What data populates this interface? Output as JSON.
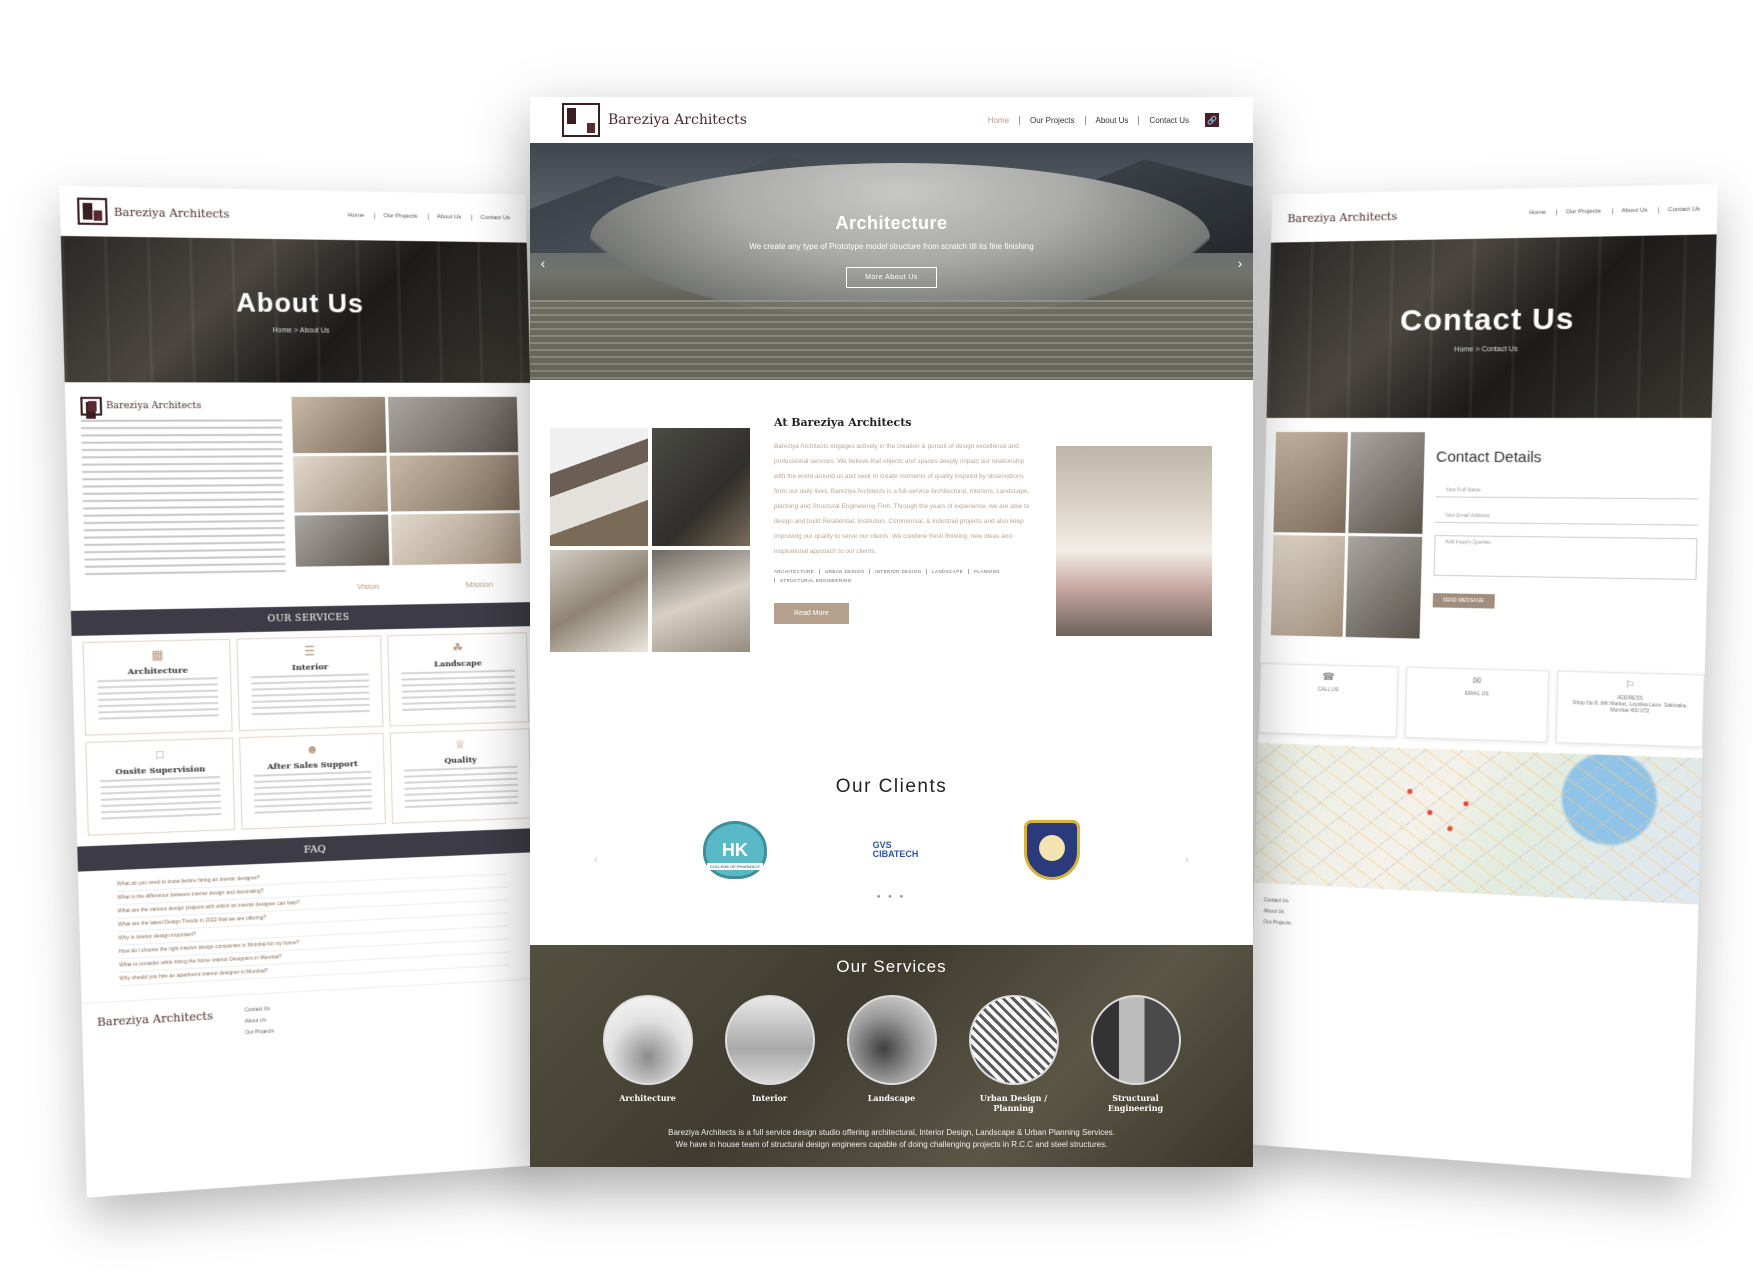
{
  "brand": {
    "name": "Bareziya Architects"
  },
  "nav": {
    "home": "Home",
    "projects": "Our Projects",
    "about": "About Us",
    "contact": "Contact Us"
  },
  "hero": {
    "title": "Architecture",
    "subtitle": "We create any type of Prototype model structure from scratch till its fine finishing",
    "button": "More About Us"
  },
  "about": {
    "heading": "At Bareziya Architects",
    "body": "Bareziya Architects engages actively in the creation & pursuit of design excellence and professional services. We believe that objects and spaces deeply impact our relationship with the world around us and seek to create moments of quality inspired by observations from our daily lives. Bareziya Architects is a full-service Architectural, Interiors, Landscape, planning and Structural Engineering Firm. Through the years of experience, we are able to design and build Residential, Institution, Commercial, & Industrial projects and also keep improving our quality to serve our clients. We combine fresh thinking, new ideas and inspirational approach to our clients.",
    "tags": [
      "ARCHITECTURE",
      "URBAN DESIGN",
      "INTERIOR DESIGN",
      "LANDSCAPE",
      "PLANNING",
      "STRUCTURAL ENGINEERING"
    ],
    "button": "Read More"
  },
  "clients": {
    "heading": "Our Clients",
    "hk_text": "HK",
    "hk_banner": "COLLEGE OF PHARMACY",
    "gvs_line1": "GVS",
    "gvs_line2": "CIBATECH"
  },
  "services": {
    "heading": "Our Services",
    "items": [
      "Architecture",
      "Interior",
      "Landscape",
      "Urban Design / Planning",
      "Structural Engineering"
    ],
    "text_line1": "Bareziya Architects is a full service design studio offering architectural, Interior Design, Landscape & Urban Planning Services.",
    "text_line2": "We have in house team of structural design engineers capable of doing challenging projects in R.C.C and steel structures."
  },
  "left": {
    "title": "About Us",
    "crumb": "Home  >  About Us",
    "vision": "Vision",
    "mission": "Mission",
    "services_bar": "OUR SERVICES",
    "service_cards": [
      "Architecture",
      "Interior",
      "Landscape",
      "Onsite Supervision",
      "After Sales Support",
      "Quality"
    ],
    "faq_bar": "FAQ",
    "faqs": [
      "What do you need to know before hiring an interior designer?",
      "What is the difference between interior design and decorating?",
      "What are the various design projects with which an interior designer can help?",
      "What are the latest Design Trends in 2022 that we are offering?",
      "Why is interior design important?",
      "How do I choose the right interior design companies in Mumbai for my home?",
      "What to consider while hiring the home interior Designers in Mumbai?",
      "Why should you hire an apartment interior designer in Mumbai?"
    ]
  },
  "right": {
    "title": "Contact Us",
    "crumb": "Home  >  Contact Us",
    "form_title": "Contact Details",
    "field_name": "Your Full Name",
    "field_email": "Your Email Address",
    "field_msg": "Add Inquiry Queries",
    "send": "SEND MESSAGE",
    "call_label": "CALL US",
    "email_label": "EMAIL US",
    "address_label": "ADDRESS",
    "address": "Shop No 8, MK Market, Loyolka Lane, Sakinaka, Mumbai 400 072"
  }
}
